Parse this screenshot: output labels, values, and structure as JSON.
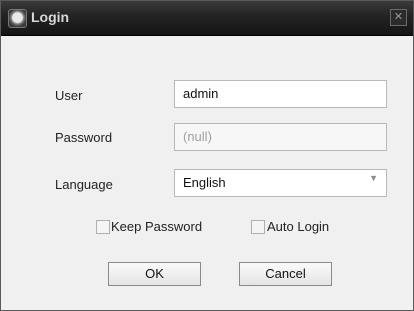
{
  "window": {
    "title": "Login",
    "close_glyph": "✕"
  },
  "form": {
    "user": {
      "label": "User",
      "value": "admin"
    },
    "password": {
      "label": "Password",
      "value": "(null)"
    },
    "language": {
      "label": "Language",
      "value": "English",
      "arrow_glyph": "▼"
    }
  },
  "options": {
    "keep_password": {
      "label": "Keep Password",
      "checked": false
    },
    "auto_login": {
      "label": "Auto Login",
      "checked": false
    }
  },
  "buttons": {
    "ok": "OK",
    "cancel": "Cancel"
  },
  "icons": {
    "app": "app-logo-icon",
    "close": "close-icon",
    "dropdown": "chevron-down-icon"
  }
}
